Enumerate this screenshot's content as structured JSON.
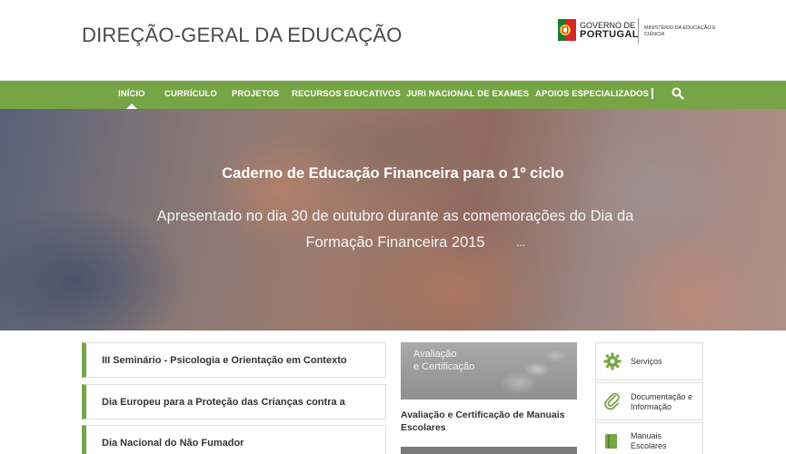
{
  "header": {
    "site_title": "DIREÇÃO-GERAL DA EDUCAÇÃO",
    "gov_top": "GOVERNO DE",
    "gov_bottom": "PORTUGAL",
    "ministry": "MINISTÉRIO DA EDUCAÇÃO E CIÊNCIA"
  },
  "nav": {
    "items": [
      {
        "label": "INÍCIO",
        "active": true
      },
      {
        "label": "CURRÍCULO"
      },
      {
        "label": "PROJETOS"
      },
      {
        "label": "RECURSOS EDUCATIVOS"
      },
      {
        "label": "JURI NACIONAL DE EXAMES"
      },
      {
        "label": "APOIOS ESPECIALIZADOS"
      }
    ],
    "search_icon": "search-icon"
  },
  "hero": {
    "title": "Caderno de Educação Financeira para o 1º ciclo",
    "subtitle": "Apresentado no dia 30 de outubro durante as comemorações do Dia da Formação Financeira 2015",
    "ellipsis": "..."
  },
  "news": [
    {
      "label": "III Seminário - Psicologia e Orientação em Contexto"
    },
    {
      "label": "Dia Europeu para a Proteção das Crianças contra a"
    },
    {
      "label": "Dia Nacional do Não Fumador"
    }
  ],
  "featured": {
    "image_text_line1": "Avaliação",
    "image_text_line2": "e Certificação",
    "title": "Avaliação e Certificação de Manuais Escolares"
  },
  "services": [
    {
      "label": "Serviços",
      "icon": "gear-icon"
    },
    {
      "label": "Documentação e Informação",
      "icon": "paperclip-icon"
    },
    {
      "label": "Manuais Escolares",
      "icon": "book-icon"
    }
  ],
  "colors": {
    "accent_green": "#76a545"
  }
}
